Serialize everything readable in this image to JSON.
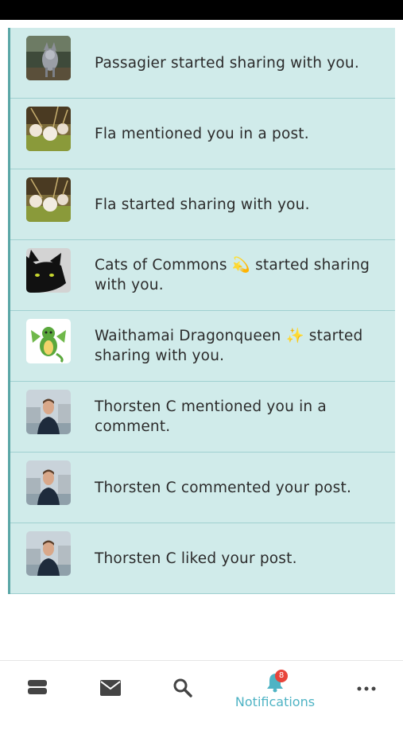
{
  "notifications": [
    {
      "text": "Passagier started sharing with you.",
      "avatar_icon": "wolf-photo-icon"
    },
    {
      "text": "Fla mentioned you in a post.",
      "avatar_icon": "flowers-photo-icon"
    },
    {
      "text": "Fla started sharing with you.",
      "avatar_icon": "flowers-photo-icon"
    },
    {
      "text": "Cats of Commons 💫 started sharing with you.",
      "avatar_icon": "black-cat-icon"
    },
    {
      "text": "Waithamai Dragonqueen ✨ started sharing with you.",
      "avatar_icon": "dragon-icon"
    },
    {
      "text": "Thorsten C mentioned you in a comment.",
      "avatar_icon": "man-portrait-icon"
    },
    {
      "text": "Thorsten C commented your post.",
      "avatar_icon": "man-portrait-icon"
    },
    {
      "text": "Thorsten C liked your post.",
      "avatar_icon": "man-portrait-icon"
    }
  ],
  "nav": {
    "timeline_icon": "stack-icon",
    "messages_icon": "envelope-icon",
    "search_icon": "search-icon",
    "notifications_icon": "bell-icon",
    "notifications_label": "Notifications",
    "notifications_badge": "8",
    "more_icon": "more-dots-icon"
  },
  "colors": {
    "item_bg": "#d0ebea",
    "accent": "#4eb3c4",
    "badge": "#e8443a"
  }
}
